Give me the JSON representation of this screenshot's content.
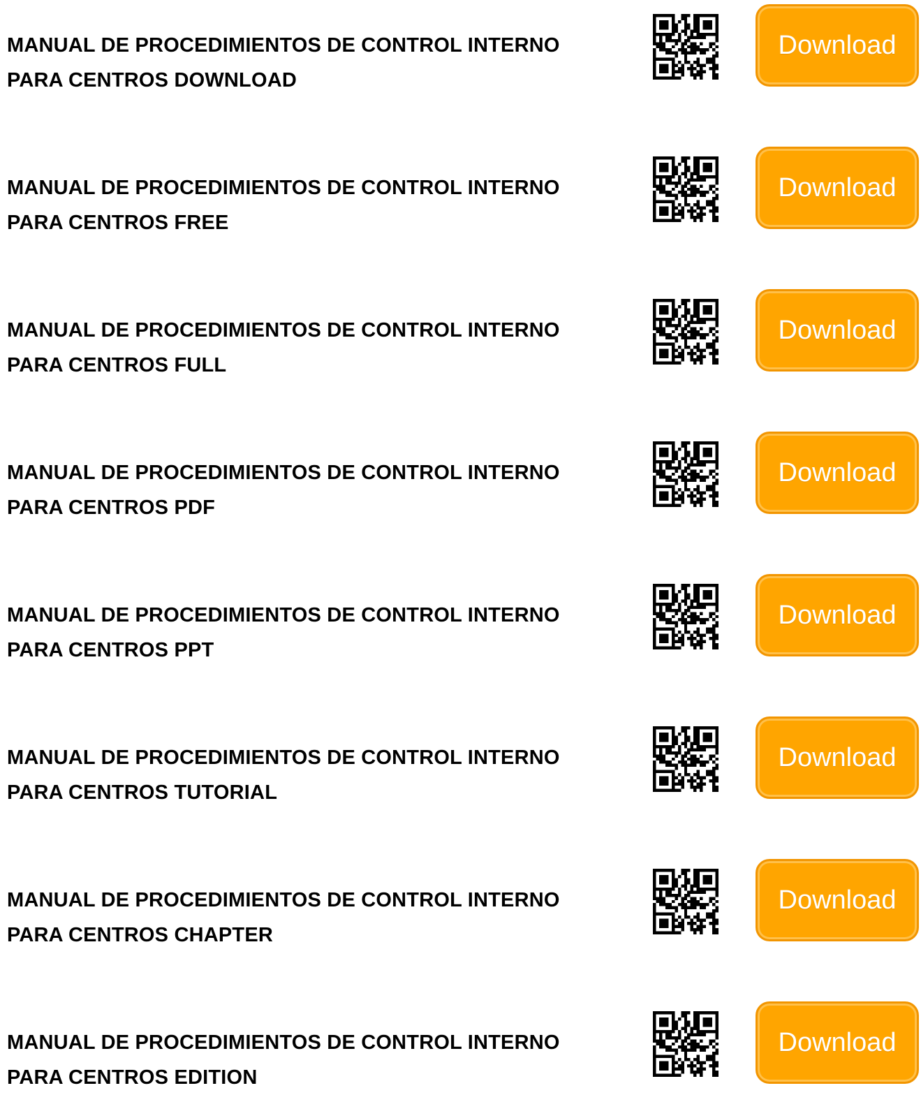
{
  "accent_color": "#ffa500",
  "button_icon": "qr-code-icon",
  "items": [
    {
      "line1": "MANUAL DE PROCEDIMIENTOS DE CONTROL INTERNO",
      "line2": "PARA CENTROS DOWNLOAD",
      "button": "Download"
    },
    {
      "line1": "MANUAL DE PROCEDIMIENTOS DE CONTROL INTERNO",
      "line2": "PARA CENTROS FREE",
      "button": "Download"
    },
    {
      "line1": "MANUAL DE PROCEDIMIENTOS DE CONTROL INTERNO",
      "line2": "PARA CENTROS FULL",
      "button": "Download"
    },
    {
      "line1": "MANUAL DE PROCEDIMIENTOS DE CONTROL INTERNO",
      "line2": "PARA CENTROS PDF",
      "button": "Download"
    },
    {
      "line1": "MANUAL DE PROCEDIMIENTOS DE CONTROL INTERNO",
      "line2": "PARA CENTROS PPT",
      "button": "Download"
    },
    {
      "line1": "MANUAL DE PROCEDIMIENTOS DE CONTROL INTERNO",
      "line2": "PARA CENTROS TUTORIAL",
      "button": "Download"
    },
    {
      "line1": "MANUAL DE PROCEDIMIENTOS DE CONTROL INTERNO",
      "line2": "PARA CENTROS CHAPTER",
      "button": "Download"
    },
    {
      "line1": "MANUAL DE PROCEDIMIENTOS DE CONTROL INTERNO",
      "line2": "PARA CENTROS EDITION",
      "button": "Download"
    }
  ]
}
